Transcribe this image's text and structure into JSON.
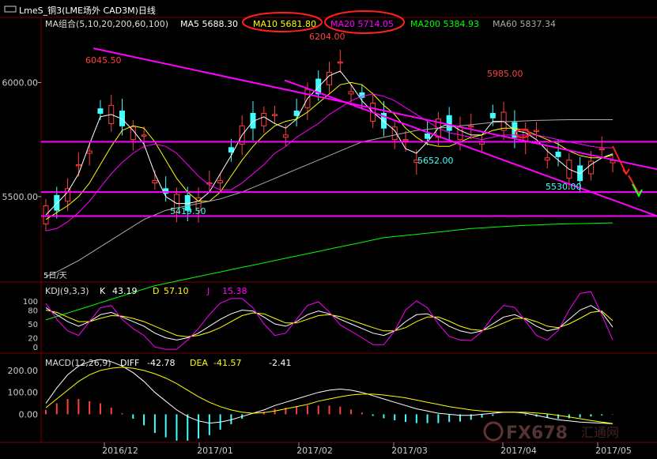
{
  "title_bar": {
    "icon": "window-icon",
    "title": "LmeS_铜3(LME场外 CAD3M)日线"
  },
  "ma_legend": {
    "group": "MA组合(5,10,20,200,60,100)",
    "items": [
      {
        "label": "MA5 5688.30",
        "color": "#ffffff"
      },
      {
        "label": "MA10 5681.80",
        "color": "#ffff00"
      },
      {
        "label": "MA20 5714.05",
        "color": "#ff00ff"
      },
      {
        "label": "MA200 5384.93",
        "color": "#00ff00"
      },
      {
        "label": "MA60 5837.34",
        "color": "#aaaaaa"
      }
    ]
  },
  "price_panel": {
    "y_ticks": [
      "6000.00",
      "5500.00"
    ],
    "annotations": [
      {
        "text": "6204.00",
        "color": "#ff4040"
      },
      {
        "text": "6045.50",
        "color": "#ff4040"
      },
      {
        "text": "5985.00",
        "color": "#ff4040"
      },
      {
        "text": "5652.00",
        "color": "#40ffff"
      },
      {
        "text": "5530.00",
        "color": "#40ffff"
      },
      {
        "text": "5419.50",
        "color": "#40ffff"
      }
    ],
    "bottom_label": "5日/天",
    "horizontal_levels": [
      5740,
      5520,
      5415
    ],
    "colors": {
      "up": "#ff4040",
      "down": "#40ffff",
      "trendline": "#ff00ff",
      "level": "#ff00ff"
    }
  },
  "kdj_panel": {
    "label": "KDJ(9,3,3)",
    "k_label": "K",
    "k_value": "43.19",
    "d_label": "D",
    "d_value": "57.10",
    "j_label": "J",
    "j_value": "15.38",
    "y_ticks": [
      "100",
      "80",
      "50",
      "20",
      "0"
    ]
  },
  "macd_panel": {
    "label": "MACD(12,26,9)",
    "diff_label": "DIFF",
    "diff_value": "-42.78",
    "dea_label": "DEA",
    "dea_value": "-41.57",
    "macd_value": "-2.41",
    "y_ticks": [
      "200.00",
      "100.00",
      "0.00"
    ]
  },
  "x_axis": {
    "labels": [
      "2016/12",
      "2017/01",
      "2017/02",
      "2017/03",
      "2017/04",
      "2017/05"
    ]
  },
  "watermark": {
    "text": "FX678",
    "suffix": "汇通网"
  },
  "chart_data": {
    "type": "line",
    "title": "LmeS_铜3(LME场外 CAD3M)日线",
    "ylim": [
      5150,
      6230
    ],
    "series": [
      {
        "name": "MA5",
        "values": [
          5420,
          5470,
          5520,
          5600,
          5730,
          5850,
          5860,
          5840,
          5790,
          5730,
          5600,
          5500,
          5470,
          5470,
          5480,
          5520,
          5600,
          5680,
          5770,
          5830,
          5850,
          5820,
          5800,
          5840,
          5930,
          5980,
          6030,
          6050,
          5990,
          5920,
          5870,
          5830,
          5790,
          5710,
          5690,
          5740,
          5800,
          5820,
          5790,
          5770,
          5770,
          5830,
          5830,
          5790,
          5780,
          5750,
          5700,
          5660,
          5620,
          5600,
          5640,
          5670,
          5688
        ]
      },
      {
        "name": "MA10",
        "values": [
          5400,
          5430,
          5460,
          5500,
          5560,
          5640,
          5720,
          5790,
          5810,
          5800,
          5740,
          5660,
          5580,
          5520,
          5480,
          5480,
          5520,
          5590,
          5660,
          5720,
          5770,
          5810,
          5830,
          5840,
          5870,
          5910,
          5950,
          5990,
          6000,
          5990,
          5950,
          5900,
          5860,
          5800,
          5760,
          5730,
          5720,
          5720,
          5740,
          5760,
          5770,
          5790,
          5800,
          5800,
          5790,
          5770,
          5750,
          5730,
          5700,
          5680,
          5670,
          5670,
          5682
        ]
      },
      {
        "name": "MA20",
        "values": [
          5350,
          5360,
          5390,
          5430,
          5480,
          5540,
          5600,
          5650,
          5690,
          5720,
          5730,
          5720,
          5690,
          5640,
          5590,
          5550,
          5530,
          5530,
          5560,
          5600,
          5640,
          5690,
          5720,
          5760,
          5790,
          5820,
          5860,
          5890,
          5920,
          5940,
          5950,
          5940,
          5920,
          5890,
          5860,
          5830,
          5800,
          5780,
          5770,
          5760,
          5750,
          5760,
          5770,
          5770,
          5770,
          5770,
          5760,
          5750,
          5740,
          5730,
          5720,
          5715,
          5714
        ]
      },
      {
        "name": "MA60",
        "values": [
          5150,
          5170,
          5195,
          5220,
          5250,
          5280,
          5310,
          5340,
          5370,
          5400,
          5420,
          5440,
          5450,
          5460,
          5470,
          5480,
          5490,
          5505,
          5520,
          5540,
          5560,
          5580,
          5600,
          5620,
          5640,
          5660,
          5680,
          5700,
          5720,
          5740,
          5750,
          5760,
          5770,
          5780,
          5790,
          5795,
          5800,
          5805,
          5810,
          5815,
          5820,
          5825,
          5828,
          5830,
          5832,
          5834,
          5835,
          5836,
          5837,
          5837,
          5837,
          5837,
          5837
        ]
      },
      {
        "name": "MA200",
        "values": [
          4960,
          4975,
          4990,
          5005,
          5020,
          5035,
          5050,
          5065,
          5080,
          5095,
          5110,
          5120,
          5130,
          5140,
          5150,
          5160,
          5170,
          5180,
          5190,
          5200,
          5210,
          5220,
          5230,
          5240,
          5250,
          5260,
          5270,
          5280,
          5290,
          5300,
          5310,
          5320,
          5325,
          5330,
          5335,
          5340,
          5345,
          5350,
          5355,
          5360,
          5363,
          5366,
          5369,
          5372,
          5374,
          5376,
          5378,
          5380,
          5381,
          5382,
          5383,
          5384,
          5385
        ]
      }
    ],
    "kdj": {
      "ylim": [
        0,
        100
      ],
      "K": [
        85,
        70,
        55,
        45,
        55,
        70,
        75,
        65,
        55,
        45,
        30,
        20,
        15,
        20,
        30,
        45,
        60,
        72,
        80,
        78,
        65,
        50,
        45,
        55,
        70,
        78,
        72,
        60,
        50,
        40,
        30,
        25,
        35,
        55,
        70,
        72,
        60,
        45,
        35,
        30,
        35,
        50,
        65,
        70,
        60,
        45,
        35,
        40,
        60,
        80,
        90,
        75,
        43
      ],
      "D": [
        80,
        75,
        65,
        55,
        55,
        62,
        68,
        67,
        62,
        55,
        45,
        35,
        25,
        22,
        25,
        32,
        42,
        55,
        68,
        74,
        72,
        62,
        52,
        52,
        60,
        68,
        70,
        66,
        58,
        50,
        42,
        35,
        35,
        42,
        55,
        65,
        65,
        56,
        45,
        38,
        36,
        42,
        52,
        62,
        62,
        55,
        45,
        42,
        50,
        62,
        75,
        78,
        57
      ],
      "J": [
        95,
        60,
        35,
        25,
        55,
        85,
        90,
        60,
        40,
        25,
        0,
        -5,
        -5,
        15,
        40,
        70,
        95,
        105,
        105,
        85,
        50,
        25,
        30,
        60,
        90,
        98,
        76,
        48,
        34,
        20,
        5,
        5,
        35,
        80,
        100,
        85,
        50,
        23,
        15,
        14,
        33,
        66,
        90,
        86,
        56,
        25,
        15,
        36,
        80,
        116,
        120,
        70,
        15
      ]
    },
    "macd": {
      "ylim": [
        -110,
        250
      ],
      "DIFF": [
        50,
        120,
        180,
        220,
        240,
        250,
        240,
        220,
        190,
        150,
        100,
        60,
        20,
        -10,
        -30,
        -40,
        -35,
        -25,
        -10,
        5,
        20,
        40,
        55,
        70,
        85,
        100,
        110,
        115,
        110,
        100,
        85,
        70,
        55,
        40,
        25,
        15,
        5,
        0,
        -5,
        -5,
        0,
        5,
        10,
        10,
        5,
        -5,
        -15,
        -25,
        -30,
        -35,
        -38,
        -40,
        -43
      ],
      "DEA": [
        30,
        70,
        110,
        150,
        180,
        200,
        210,
        215,
        210,
        200,
        185,
        165,
        140,
        110,
        80,
        55,
        35,
        20,
        10,
        5,
        8,
        15,
        25,
        35,
        45,
        60,
        70,
        80,
        88,
        92,
        92,
        88,
        82,
        75,
        65,
        55,
        45,
        35,
        28,
        20,
        15,
        12,
        10,
        10,
        9,
        6,
        2,
        -5,
        -12,
        -20,
        -28,
        -35,
        -42
      ],
      "MACD": [
        40,
        100,
        140,
        140,
        120,
        100,
        60,
        10,
        -40,
        -100,
        -170,
        -210,
        -240,
        -240,
        -220,
        -190,
        -140,
        -90,
        -40,
        0,
        24,
        50,
        60,
        70,
        80,
        80,
        80,
        70,
        44,
        16,
        -14,
        -36,
        -54,
        -70,
        -80,
        -80,
        -80,
        -70,
        -66,
        -50,
        -30,
        -14,
        0,
        0,
        -8,
        -22,
        -34,
        -40,
        -36,
        -30,
        -20,
        -10,
        -2
      ]
    }
  }
}
